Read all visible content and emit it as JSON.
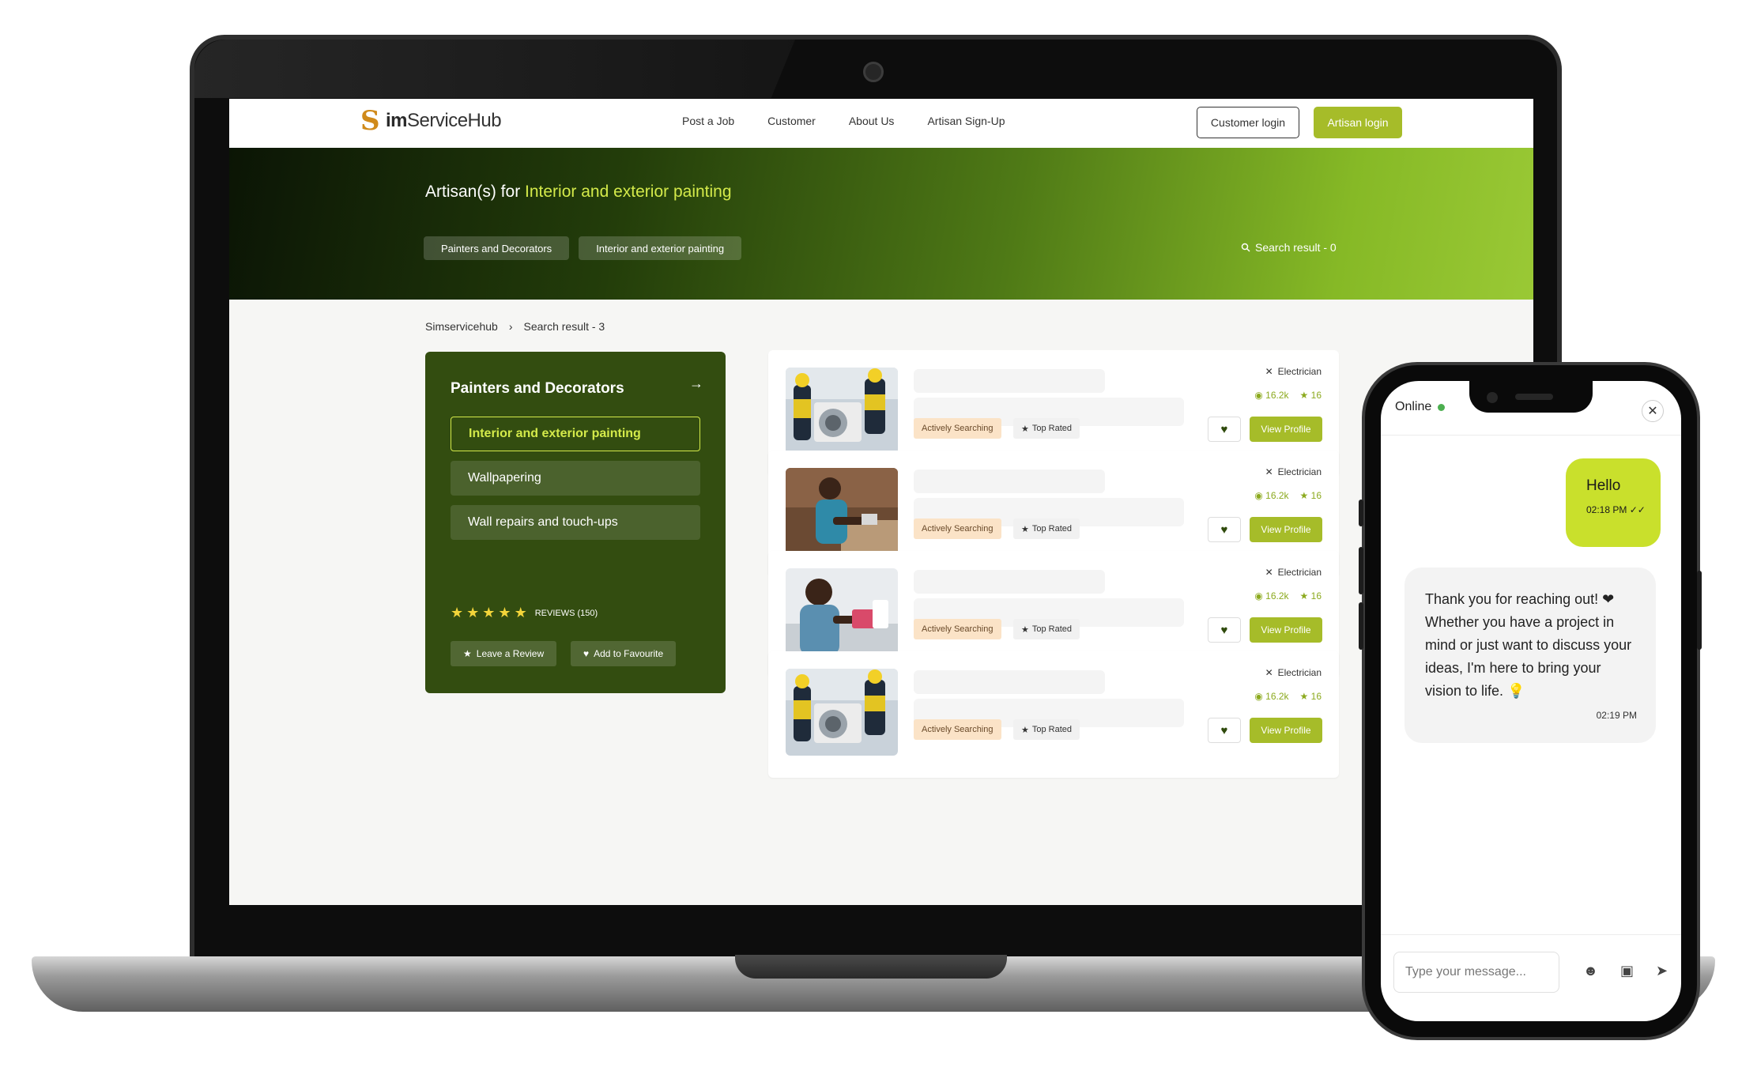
{
  "nav": {
    "logo_s": "S",
    "logo_text_bold": "im",
    "logo_text_rest": "ServiceHub",
    "links": [
      "Post a Job",
      "Customer",
      "About Us",
      "Artisan Sign-Up"
    ],
    "customer_login": "Customer login",
    "artisan_login": "Artisan login"
  },
  "hero": {
    "title_prefix": "Artisan(s) for",
    "title_highlight": "Interior and exterior painting",
    "chips": [
      "Painters and Decorators",
      "Interior and exterior painting"
    ],
    "search_result": "Search result - 0"
  },
  "breadcrumb": {
    "home": "Simservicehub",
    "separator": "›",
    "current": "Search result - 3"
  },
  "sidebar": {
    "title": "Painters and Decorators",
    "items": [
      {
        "label": "Interior and exterior painting",
        "active": true
      },
      {
        "label": "Wallpapering",
        "active": false
      },
      {
        "label": "Wall repairs and touch-ups",
        "active": false
      }
    ],
    "rating_stars": 5,
    "reviews_label": "REVIEWS (150)",
    "leave_review": "Leave a Review",
    "add_favourite": "Add to Favourite"
  },
  "results": [
    {
      "role": "Electrician",
      "views": "16.2k",
      "rating": "16",
      "tag_searching": "Actively Searching",
      "tag_rated": "Top Rated",
      "view_label": "View Profile",
      "photo": "technicians-ac-unit"
    },
    {
      "role": "Electrician",
      "views": "16.2k",
      "rating": "16",
      "tag_searching": "Actively Searching",
      "tag_rated": "Top Rated",
      "view_label": "View Profile",
      "photo": "woman-workbench"
    },
    {
      "role": "Electrician",
      "views": "16.2k",
      "rating": "16",
      "tag_searching": "Actively Searching",
      "tag_rated": "Top Rated",
      "view_label": "View Profile",
      "photo": "woman-electronics"
    },
    {
      "role": "Electrician",
      "views": "16.2k",
      "rating": "16",
      "tag_searching": "Actively Searching",
      "tag_rated": "Top Rated",
      "view_label": "View Profile",
      "photo": "technicians-ac-unit"
    }
  ],
  "chat": {
    "status": "Online",
    "messages": [
      {
        "from": "me",
        "text": "Hello",
        "time": "02:18 PM"
      },
      {
        "from": "them",
        "text": "Thank you for reaching out! ❤ Whether you have a project in mind or just want to discuss your ideas, I'm here to bring your vision to life. 💡",
        "time": "02:19 PM"
      }
    ],
    "input_placeholder": "Type your message..."
  },
  "colors": {
    "accent": "#a6bc29",
    "panel_green": "#334d10",
    "highlight": "#d4ea4a",
    "chat_bubble": "#c9e02c"
  }
}
